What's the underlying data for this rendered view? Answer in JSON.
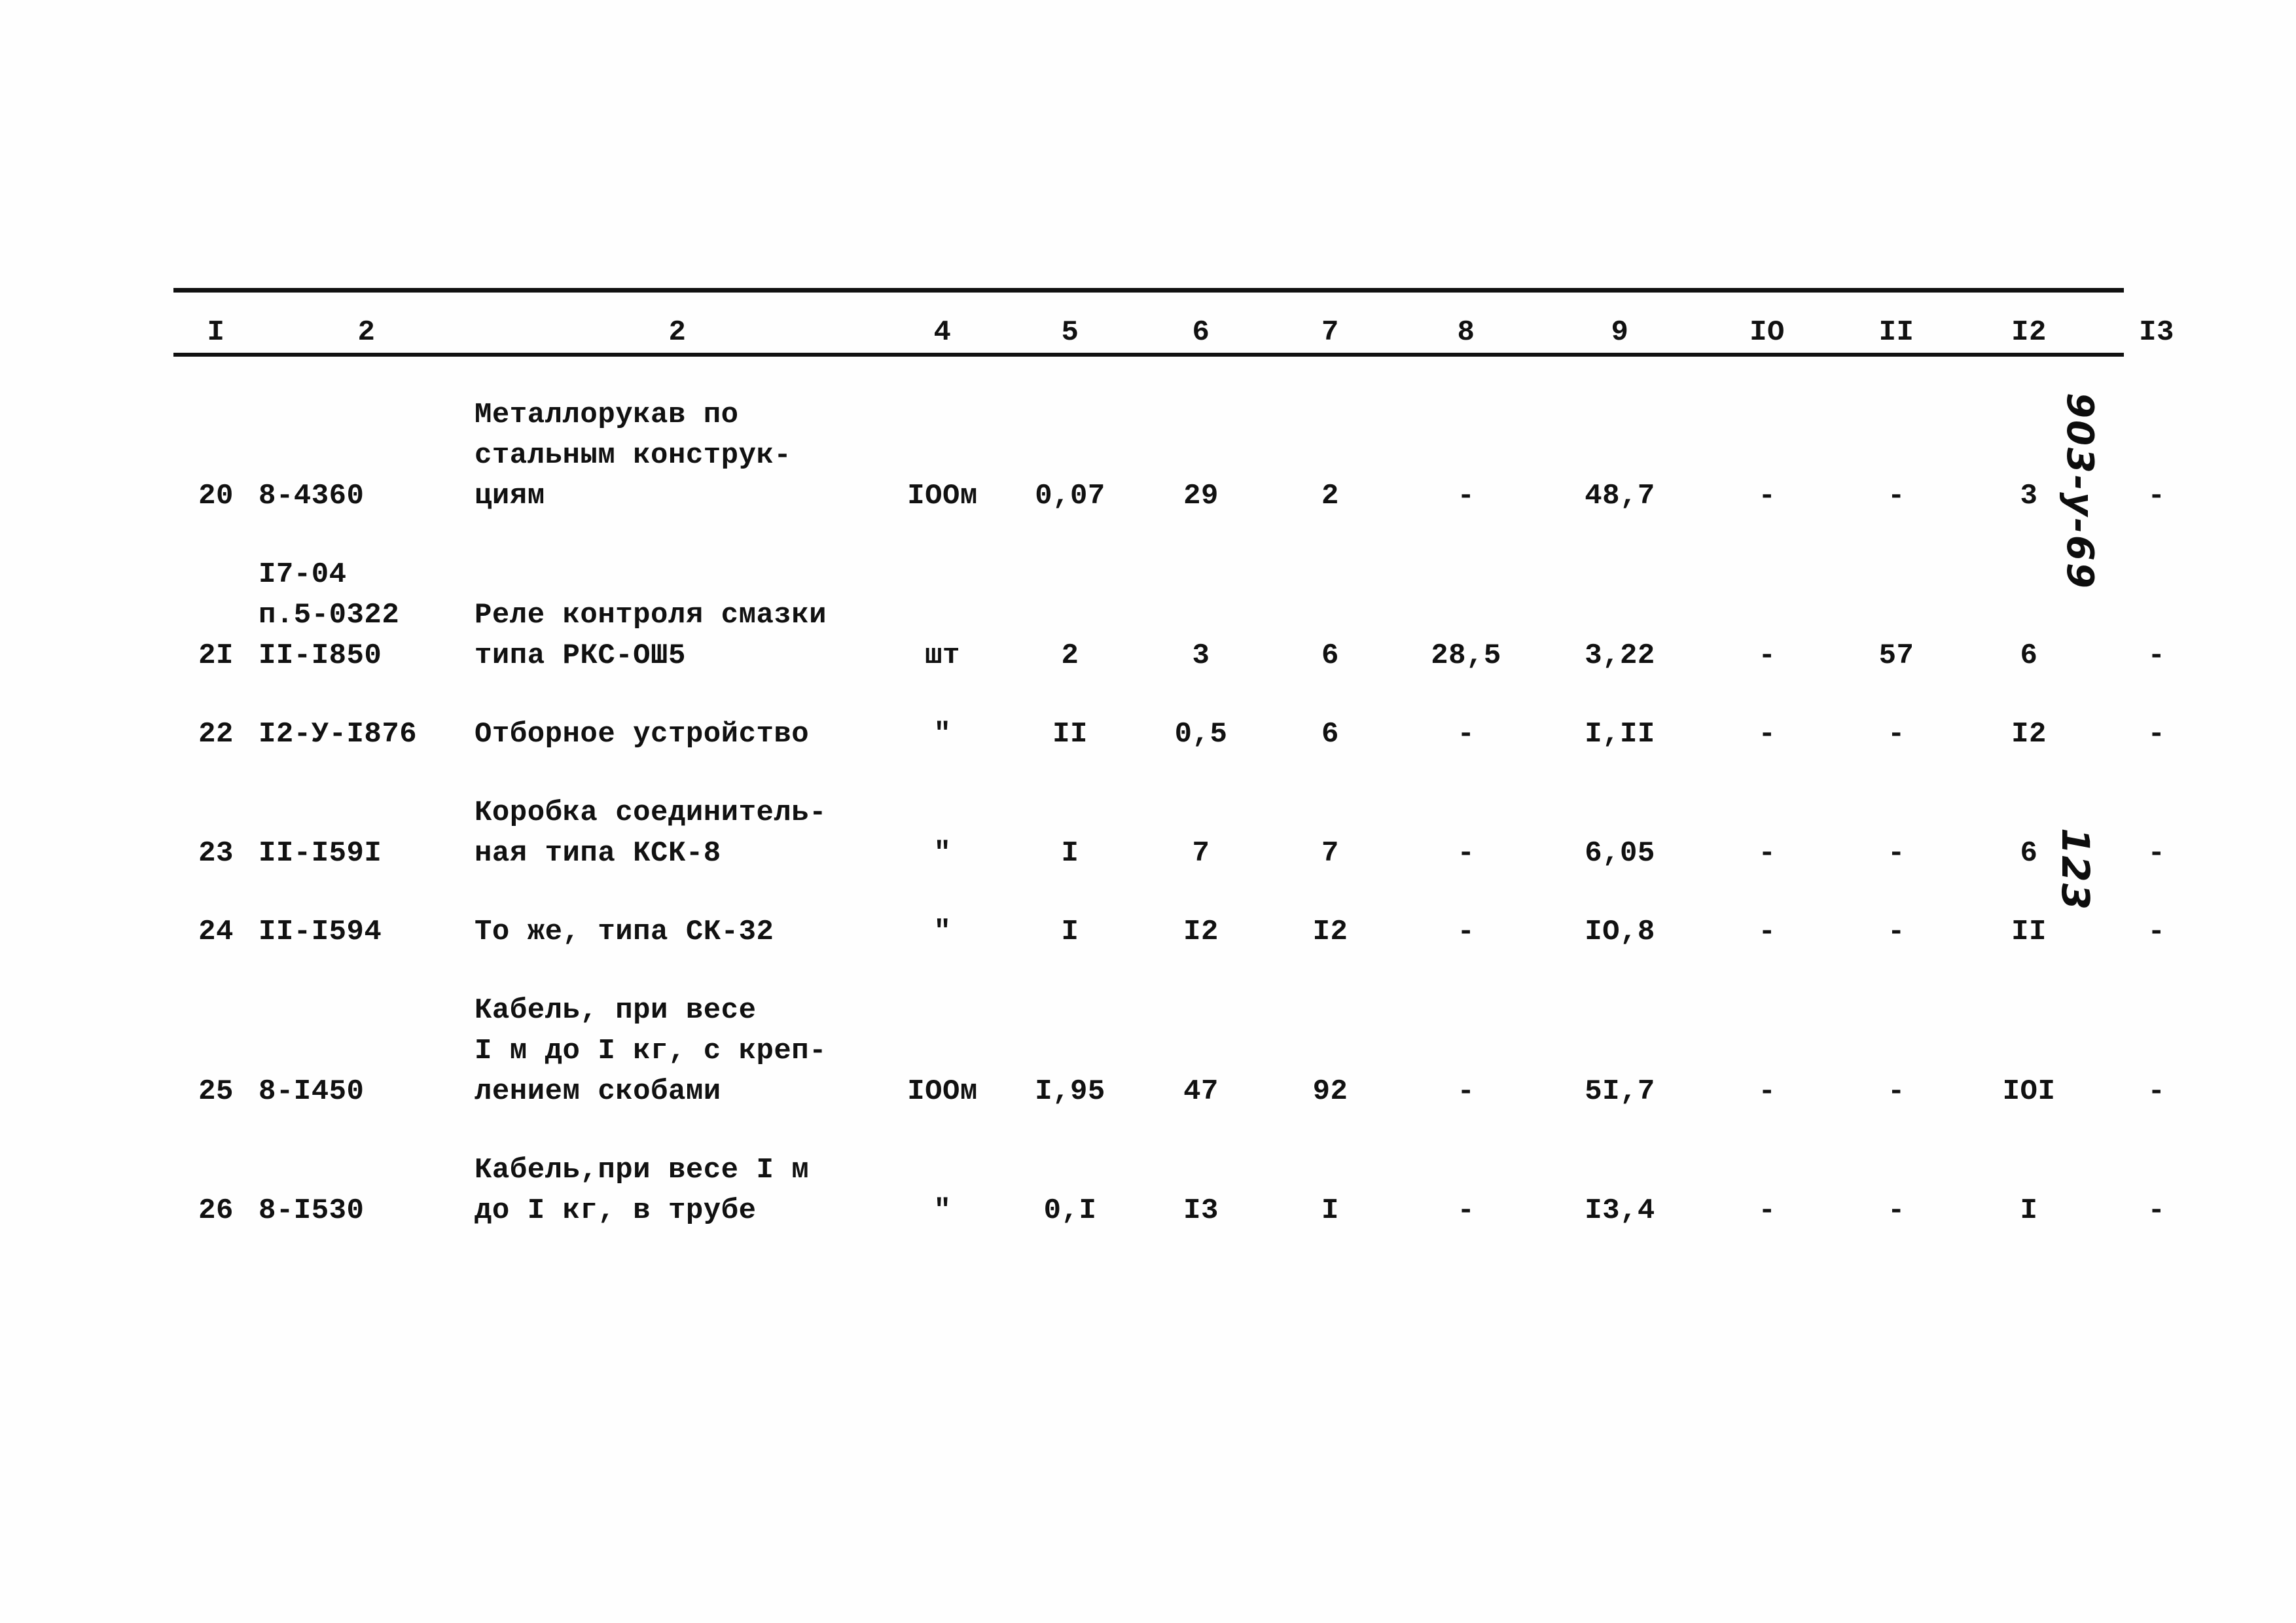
{
  "document": {
    "kind": "scanned-technical-table",
    "column_headers": [
      "I",
      "2",
      "2",
      "4",
      "5",
      "6",
      "7",
      "8",
      "9",
      "IO",
      "II",
      "I2",
      "I3"
    ],
    "rows": [
      {
        "no": "20",
        "code": "8-4360",
        "name": "Металлорукав по\nстальным конструк-\nциям",
        "unit": "IOOм",
        "c5": "0,07",
        "c6": "29",
        "c7": "2",
        "c8": "-",
        "c9": "48,7",
        "c10": "-",
        "c11": "-",
        "c12": "3",
        "c13": "-"
      },
      {
        "no": "2I",
        "code": "I7-04\nп.5-0322\nII-I850",
        "name": "Реле контроля смазки\nтипа РКС-ОШ5",
        "unit": "шт",
        "c5": "2",
        "c6": "3",
        "c7": "6",
        "c8": "28,5",
        "c9": "3,22",
        "c10": "-",
        "c11": "57",
        "c12": "6",
        "c13": "-"
      },
      {
        "no": "22",
        "code": "I2-У-I876",
        "name": "Отборное устройство",
        "unit": "\"",
        "c5": "II",
        "c6": "0,5",
        "c7": "6",
        "c8": "-",
        "c9": "I,II",
        "c10": "-",
        "c11": "-",
        "c12": "I2",
        "c13": "-"
      },
      {
        "no": "23",
        "code": "II-I59I",
        "name": "Коробка соединитель-\nная типа КСК-8",
        "unit": "\"",
        "c5": "I",
        "c6": "7",
        "c7": "7",
        "c8": "-",
        "c9": "6,05",
        "c10": "-",
        "c11": "-",
        "c12": "6",
        "c13": "-"
      },
      {
        "no": "24",
        "code": "II-I594",
        "name": "То же, типа СК-32",
        "unit": "\"",
        "c5": "I",
        "c6": "I2",
        "c7": "I2",
        "c8": "-",
        "c9": "IO,8",
        "c10": "-",
        "c11": "-",
        "c12": "II",
        "c13": "-"
      },
      {
        "no": "25",
        "code": "8-I450",
        "name": "Кабель, при весе\nI м до I кг, с креп-\nлением скобами",
        "unit": "IOOм",
        "c5": "I,95",
        "c6": "47",
        "c7": "92",
        "c8": "-",
        "c9": "5I,7",
        "c10": "-",
        "c11": "-",
        "c12": "IOI",
        "c13": "-"
      },
      {
        "no": "26",
        "code": "8-I530",
        "name": "Кабель,при весе I м\nдо I кг, в трубе",
        "unit": "\"",
        "c5": "0,I",
        "c6": "I3",
        "c7": "I",
        "c8": "-",
        "c9": "I3,4",
        "c10": "-",
        "c11": "-",
        "c12": "I",
        "c13": "-"
      }
    ]
  },
  "marginalia": {
    "doc_code": "903-у-69",
    "page_number": "123"
  },
  "colors": {
    "ink": "#111111",
    "paper": "#fefefe"
  }
}
